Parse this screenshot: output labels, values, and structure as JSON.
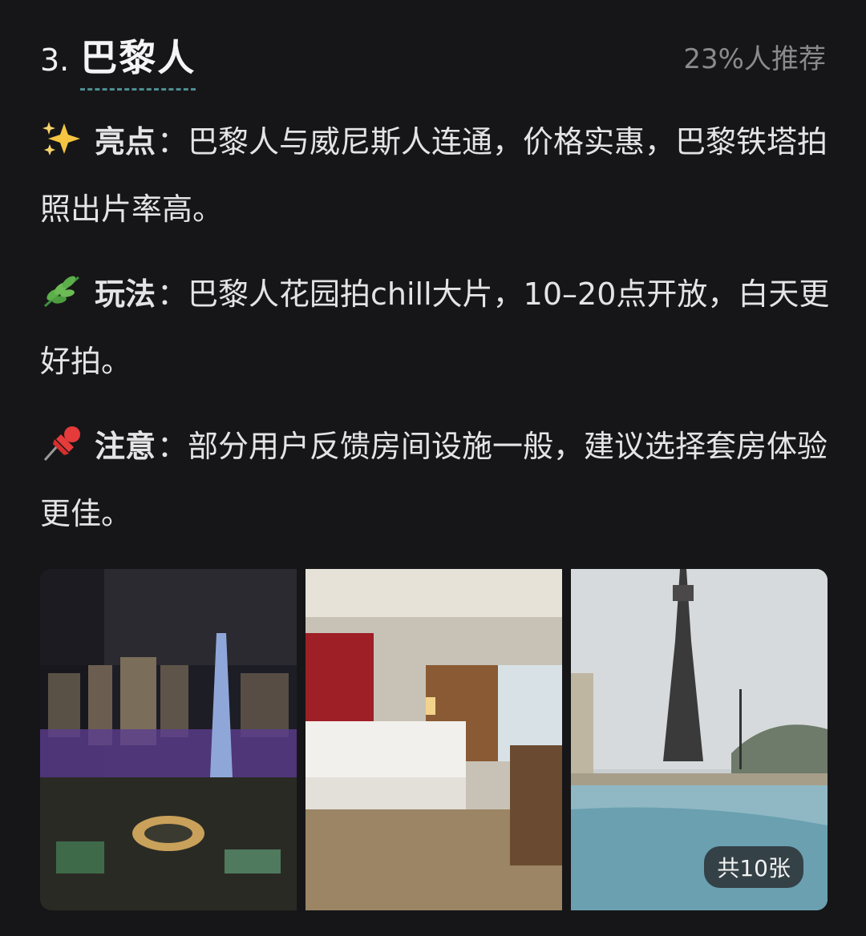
{
  "header": {
    "number": "3.",
    "name": "巴黎人",
    "recommend": "23%人推荐"
  },
  "sections": [
    {
      "icon": "sparkles-icon",
      "label": "亮点",
      "text": "：巴黎人与威尼斯人连通，价格实惠，巴黎铁塔拍照出片率高。"
    },
    {
      "icon": "herb-icon",
      "label": "玩法",
      "text": "：巴黎人花园拍chill大片，10–20点开放，白天更好拍。"
    },
    {
      "icon": "pushpin-icon",
      "label": "注意",
      "text": "：部分用户反馈房间设施一般，建议选择套房体验更佳。"
    }
  ],
  "gallery": {
    "images": [
      "night-city-eiffel-photo",
      "hotel-room-photo",
      "pool-eiffel-tower-photo"
    ],
    "count_label": "共10张"
  }
}
